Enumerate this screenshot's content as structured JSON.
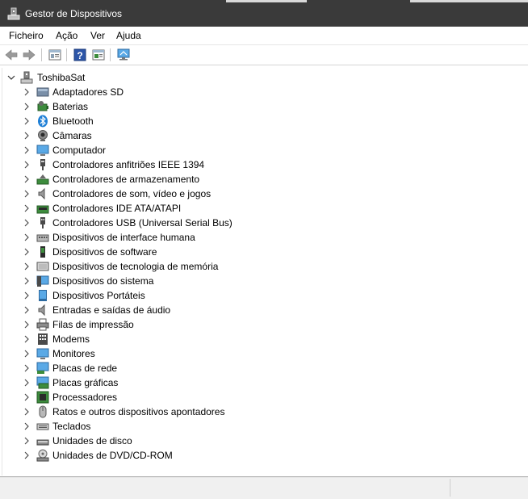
{
  "window": {
    "title": "Gestor de Dispositivos"
  },
  "menu": [
    "Ficheiro",
    "Ação",
    "Ver",
    "Ajuda"
  ],
  "toolbar": {
    "buttons": [
      "back-icon",
      "forward-icon",
      "properties-icon",
      "help-icon",
      "update-driver-icon",
      "scan-hardware-icon"
    ]
  },
  "tree": {
    "root": {
      "label": "ToshibaSat",
      "expanded": true,
      "icon": "computer-icon"
    },
    "categories": [
      {
        "label": "Adaptadores SD",
        "icon": "sd-card-icon"
      },
      {
        "label": "Baterias",
        "icon": "battery-icon"
      },
      {
        "label": "Bluetooth",
        "icon": "bluetooth-icon"
      },
      {
        "label": "Câmaras",
        "icon": "camera-icon"
      },
      {
        "label": "Computador",
        "icon": "computer-icon"
      },
      {
        "label": "Controladores anfitriões IEEE 1394",
        "icon": "ieee1394-icon"
      },
      {
        "label": "Controladores de armazenamento",
        "icon": "storage-controller-icon"
      },
      {
        "label": "Controladores de som, vídeo e jogos",
        "icon": "speaker-icon"
      },
      {
        "label": "Controladores IDE ATA/ATAPI",
        "icon": "ide-controller-icon"
      },
      {
        "label": "Controladores USB (Universal Serial Bus)",
        "icon": "usb-icon"
      },
      {
        "label": "Dispositivos de interface humana",
        "icon": "hid-icon"
      },
      {
        "label": "Dispositivos de software",
        "icon": "software-device-icon"
      },
      {
        "label": "Dispositivos de tecnologia de memória",
        "icon": "memory-tech-icon"
      },
      {
        "label": "Dispositivos do sistema",
        "icon": "system-device-icon"
      },
      {
        "label": "Dispositivos Portáteis",
        "icon": "portable-device-icon"
      },
      {
        "label": "Entradas e saídas de áudio",
        "icon": "speaker-icon"
      },
      {
        "label": "Filas de impressão",
        "icon": "printer-icon"
      },
      {
        "label": "Modems",
        "icon": "modem-icon"
      },
      {
        "label": "Monitores",
        "icon": "monitor-icon"
      },
      {
        "label": "Placas de rede",
        "icon": "network-adapter-icon"
      },
      {
        "label": "Placas gráficas",
        "icon": "display-adapter-icon"
      },
      {
        "label": "Processadores",
        "icon": "processor-icon"
      },
      {
        "label": "Ratos e outros dispositivos apontadores",
        "icon": "mouse-icon"
      },
      {
        "label": "Teclados",
        "icon": "keyboard-icon"
      },
      {
        "label": "Unidades de disco",
        "icon": "disk-drive-icon"
      },
      {
        "label": "Unidades de DVD/CD-ROM",
        "icon": "dvd-drive-icon"
      }
    ]
  },
  "colors": {
    "titlebar": "#3a3a3a",
    "title_text": "#ffffff",
    "accent_blue": "#1e7fd6"
  }
}
